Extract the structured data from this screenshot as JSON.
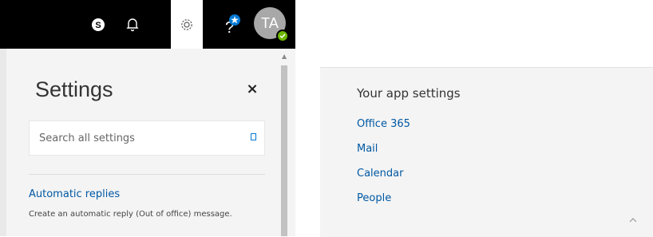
{
  "header": {
    "avatar_initials": "TA",
    "icons": [
      "skype-icon",
      "bell-icon",
      "gear-icon",
      "help-icon",
      "avatar"
    ]
  },
  "settings_pane": {
    "title": "Settings",
    "close_label": "×",
    "search_placeholder": "Search all settings",
    "automatic_replies": {
      "label": "Automatic replies",
      "description": "Create an automatic reply (Out of office) message."
    }
  },
  "app_settings": {
    "heading": "Your app settings",
    "links": [
      "Office 365",
      "Mail",
      "Calendar",
      "People"
    ]
  },
  "colors": {
    "header_bg": "#000000",
    "link": "#0058a3",
    "pane_bg": "#f4f4f4",
    "presence": "#6bb700",
    "avatar_bg": "#a8a8a8"
  }
}
